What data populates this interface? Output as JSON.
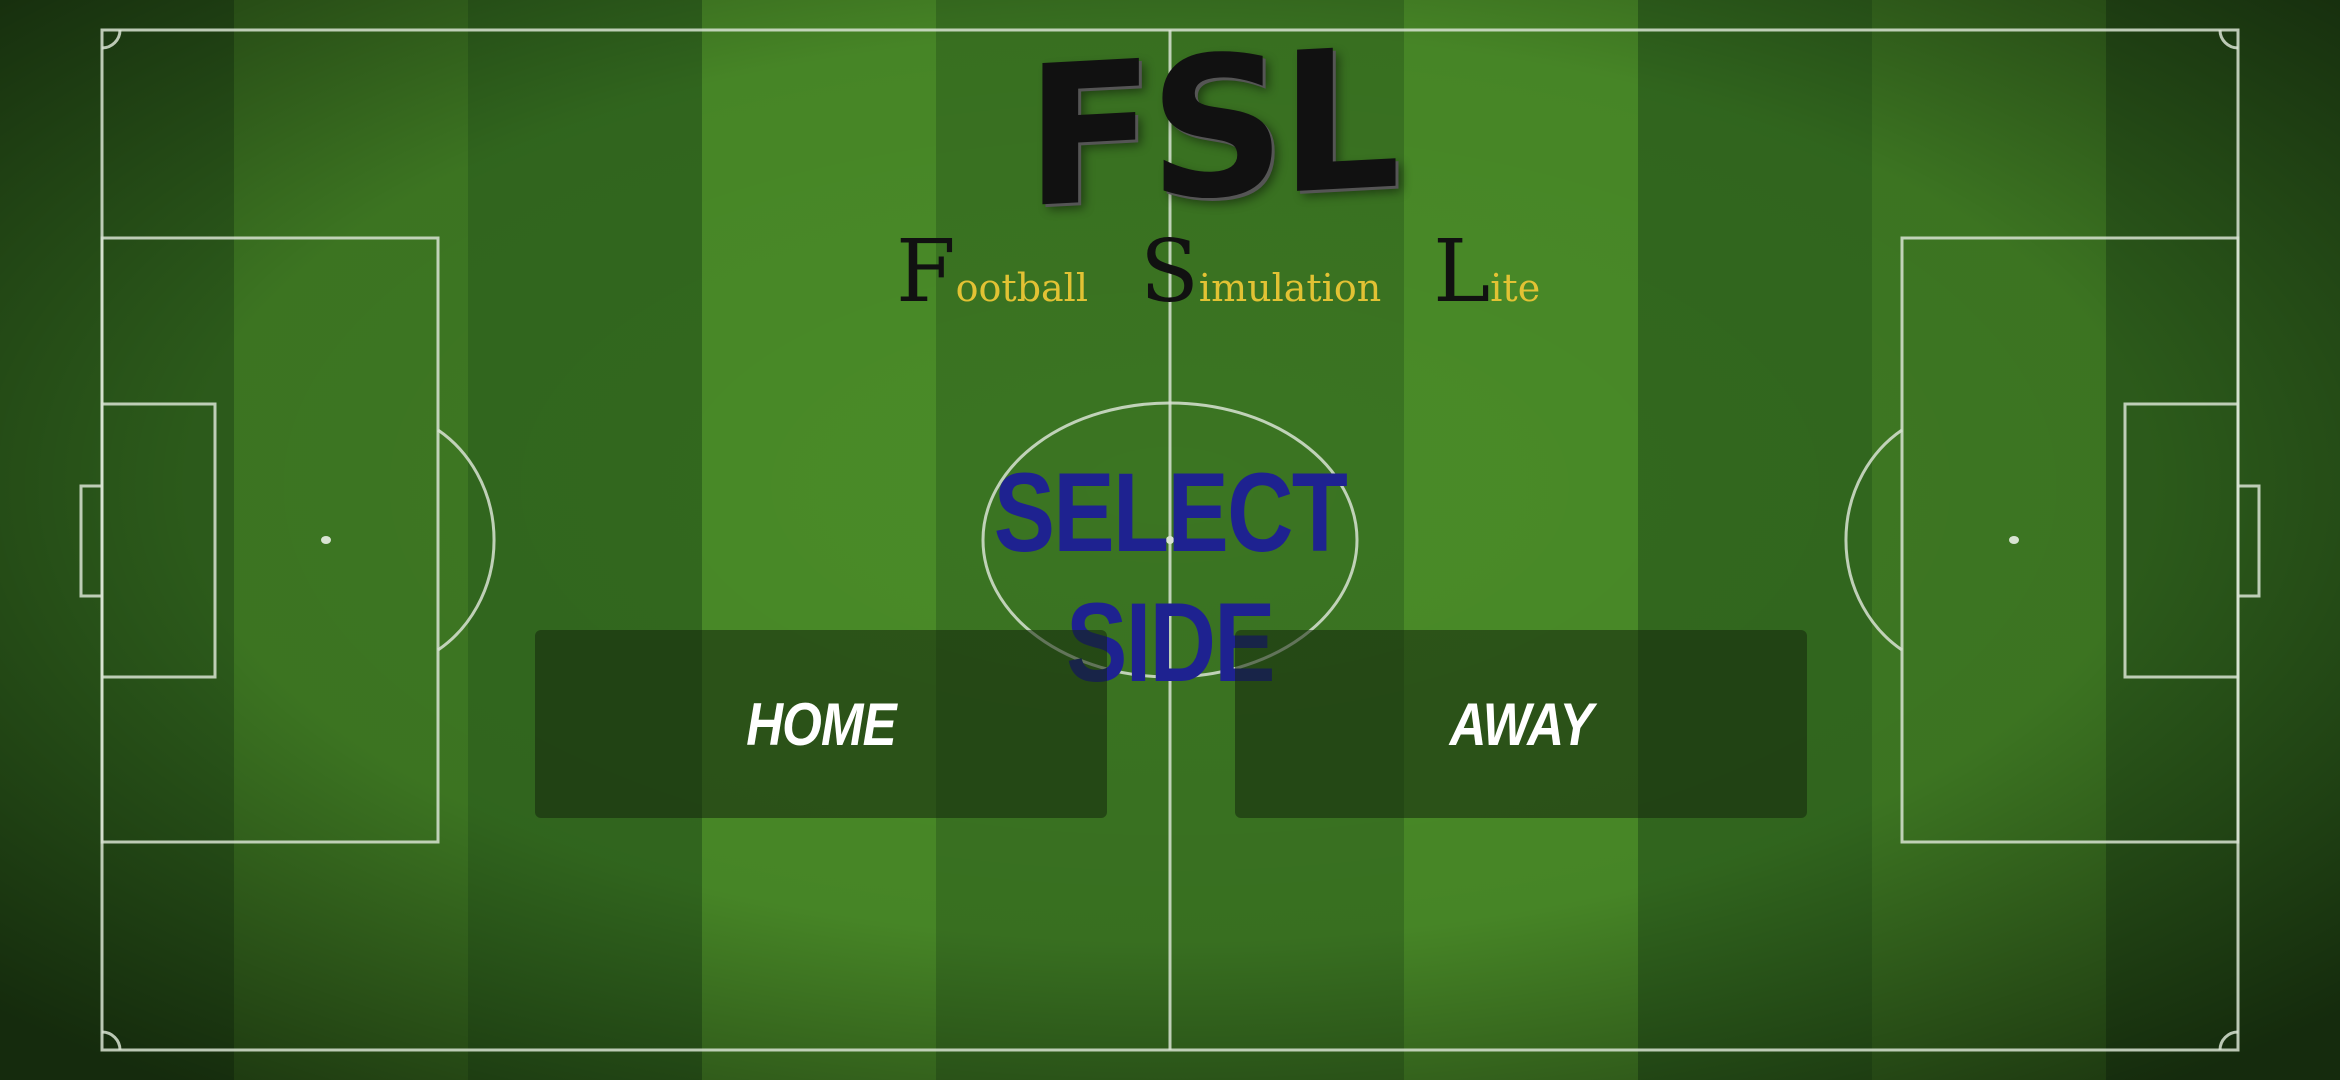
{
  "logo": {
    "text": "FSL"
  },
  "subtitle": {
    "words": [
      {
        "cap": "F",
        "rest": "ootball"
      },
      {
        "cap": "S",
        "rest": "imulation"
      },
      {
        "cap": "L",
        "rest": "ite"
      }
    ]
  },
  "heading": "SELECT SIDE",
  "buttons": {
    "home": "HOME",
    "away": "AWAY"
  },
  "colors": {
    "grass_light": "#4a8c27",
    "grass_dark": "#2f611c",
    "lines": "#d8e3d2",
    "heading": "#1e2290",
    "subtitle_accent": "#e2c234"
  }
}
